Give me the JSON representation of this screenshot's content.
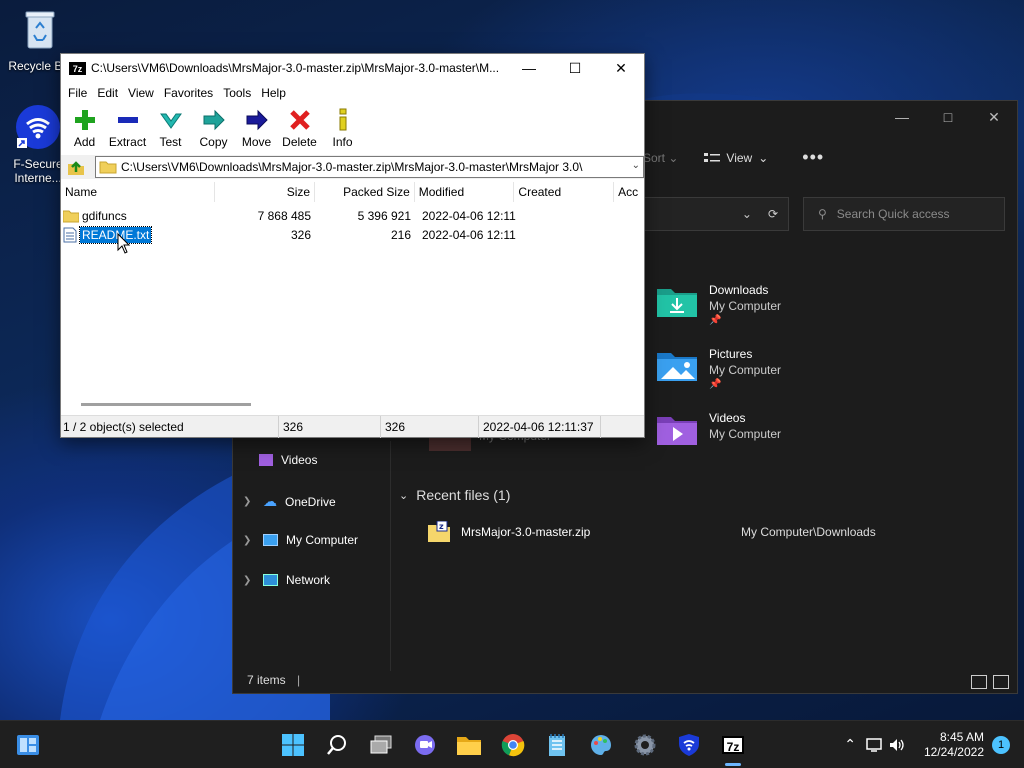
{
  "desktop": {
    "icons": [
      {
        "label": "Recycle Bin",
        "icon": "recycle-bin-icon"
      },
      {
        "label": "F-Secure Interne...",
        "icon": "f-secure-icon"
      }
    ]
  },
  "explorer": {
    "sort_label": "Sort",
    "view_label": "View",
    "more_label": "•••",
    "search_placeholder": "Search Quick access",
    "quick_access": [
      {
        "name": "Downloads",
        "location": "My Computer",
        "icon": "downloads-folder-icon"
      },
      {
        "name": "Pictures",
        "location": "My Computer",
        "icon": "pictures-folder-icon"
      },
      {
        "name": "Videos",
        "location": "My Computer",
        "icon": "videos-folder-icon"
      }
    ],
    "behind_text": "My Computer",
    "nav": [
      {
        "label": "Videos",
        "icon": "videos-icon"
      },
      {
        "label": "OneDrive",
        "icon": "onedrive-icon"
      },
      {
        "label": "My Computer",
        "icon": "computer-icon"
      },
      {
        "label": "Network",
        "icon": "network-icon"
      }
    ],
    "recent_header": "Recent files (1)",
    "recent_files": [
      {
        "name": "MrsMajor-3.0-master.zip",
        "location": "My Computer\\Downloads"
      }
    ],
    "status": "7 items"
  },
  "zip": {
    "title": "C:\\Users\\VM6\\Downloads\\MrsMajor-3.0-master.zip\\MrsMajor-3.0-master\\M...",
    "menu": [
      "File",
      "Edit",
      "View",
      "Favorites",
      "Tools",
      "Help"
    ],
    "toolbar": [
      "Add",
      "Extract",
      "Test",
      "Copy",
      "Move",
      "Delete",
      "Info"
    ],
    "path": "C:\\Users\\VM6\\Downloads\\MrsMajor-3.0-master.zip\\MrsMajor-3.0-master\\MrsMajor 3.0\\",
    "columns": [
      "Name",
      "Size",
      "Packed Size",
      "Modified",
      "Created",
      "Acc"
    ],
    "rows": [
      {
        "name": "gdifuncs",
        "size": "7 868 485",
        "packed": "5 396 921",
        "modified": "2022-04-06 12:11",
        "type": "folder"
      },
      {
        "name": "README.txt",
        "size": "326",
        "packed": "216",
        "modified": "2022-04-06 12:11",
        "type": "file"
      }
    ],
    "status": {
      "selection": "1 / 2 object(s) selected",
      "size": "326",
      "packed": "326",
      "modified": "2022-04-06 12:11:37"
    }
  },
  "taskbar": {
    "time": "8:45 AM",
    "date": "12/24/2022",
    "notifications": "1",
    "zip_label": "7z"
  },
  "colors": {
    "selection": "#0078d7",
    "explorer_bg": "#1c1c1c",
    "taskbar_bg": "#1f1f1f"
  }
}
